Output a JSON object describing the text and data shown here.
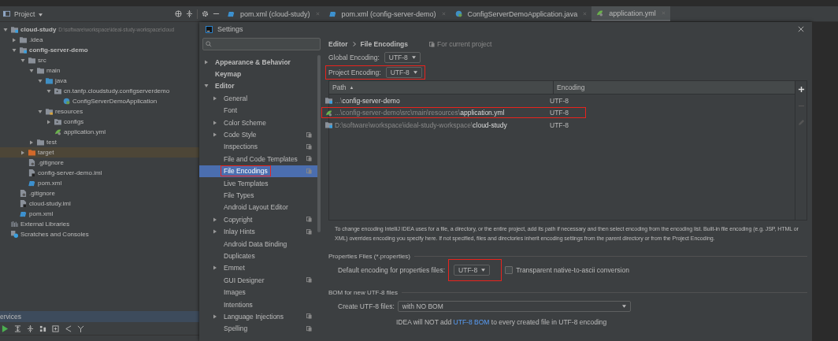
{
  "project_header": {
    "title": "Project"
  },
  "editor_tabs": [
    {
      "label": "pom.xml (cloud-study)",
      "kind": "maven",
      "selected": false
    },
    {
      "label": "pom.xml (config-server-demo)",
      "kind": "maven",
      "selected": false
    },
    {
      "label": "ConfigServerDemoApplication.java",
      "kind": "class",
      "selected": false
    },
    {
      "label": "application.yml",
      "kind": "yaml",
      "selected": true
    }
  ],
  "project_tree": [
    {
      "kind": "module",
      "name": "cloud-study",
      "hint": "D:\\software\\workspace\\ideal-study-workspace\\cloud",
      "expanded": true,
      "children": [
        {
          "kind": "folder",
          "name": ".idea",
          "expanded": false
        },
        {
          "kind": "module",
          "name": "config-server-demo",
          "expanded": true,
          "children": [
            {
              "kind": "folder",
              "name": "src",
              "expanded": true,
              "children": [
                {
                  "kind": "folder",
                  "name": "main",
                  "expanded": true,
                  "children": [
                    {
                      "kind": "source-folder",
                      "name": "java",
                      "expanded": true,
                      "children": [
                        {
                          "kind": "package",
                          "name": "cn.tanfp.cloudstudy.configserverdemo",
                          "expanded": true,
                          "children": [
                            {
                              "kind": "class",
                              "name": "ConfigServerDemoApplication"
                            }
                          ]
                        }
                      ]
                    },
                    {
                      "kind": "resources-folder",
                      "name": "resources",
                      "expanded": true,
                      "children": [
                        {
                          "kind": "package",
                          "name": "configs",
                          "expanded": false
                        },
                        {
                          "kind": "yaml",
                          "name": "application.yml"
                        }
                      ]
                    }
                  ]
                },
                {
                  "kind": "folder",
                  "name": "test",
                  "expanded": false
                }
              ]
            },
            {
              "kind": "excluded-folder",
              "name": "target",
              "expanded": false
            },
            {
              "kind": "gitignore",
              "name": ".gitignore"
            },
            {
              "kind": "iml",
              "name": "config-server-demo.iml"
            },
            {
              "kind": "maven",
              "name": "pom.xml"
            }
          ]
        },
        {
          "kind": "gitignore",
          "name": ".gitignore"
        },
        {
          "kind": "iml",
          "name": "cloud-study.iml"
        },
        {
          "kind": "maven",
          "name": "pom.xml"
        }
      ]
    },
    {
      "kind": "libraries",
      "name": "External Libraries"
    },
    {
      "kind": "scratches",
      "name": "Scratches and Consoles"
    }
  ],
  "services": {
    "title": "ervices"
  },
  "settings": {
    "title": "Settings",
    "sidebar": [
      {
        "label": "Appearance & Behavior",
        "expanded": false,
        "project_level": false,
        "selected": false
      },
      {
        "label": "Keymap",
        "project_level": false,
        "selected": false
      },
      {
        "label": "Editor",
        "expanded": true,
        "project_level": false,
        "selected": false,
        "children": [
          {
            "label": "General",
            "expanded": false,
            "project_level": false,
            "selected": false
          },
          {
            "label": "Font",
            "project_level": false,
            "selected": false
          },
          {
            "label": "Color Scheme",
            "expanded": false,
            "project_level": false,
            "selected": false
          },
          {
            "label": "Code Style",
            "expanded": false,
            "project_level": true,
            "selected": false
          },
          {
            "label": "Inspections",
            "project_level": true,
            "selected": false
          },
          {
            "label": "File and Code Templates",
            "project_level": true,
            "selected": false
          },
          {
            "label": "File Encodings",
            "project_level": true,
            "selected": true,
            "highlighted": true
          },
          {
            "label": "Live Templates",
            "project_level": false,
            "selected": false
          },
          {
            "label": "File Types",
            "project_level": false,
            "selected": false
          },
          {
            "label": "Android Layout Editor",
            "project_level": false,
            "selected": false
          },
          {
            "label": "Copyright",
            "expanded": false,
            "project_level": true,
            "selected": false
          },
          {
            "label": "Inlay Hints",
            "expanded": false,
            "project_level": true,
            "selected": false
          },
          {
            "label": "Android Data Binding",
            "project_level": false,
            "selected": false
          },
          {
            "label": "Duplicates",
            "project_level": false,
            "selected": false
          },
          {
            "label": "Emmet",
            "expanded": false,
            "project_level": false,
            "selected": false
          },
          {
            "label": "GUI Designer",
            "project_level": true,
            "selected": false
          },
          {
            "label": "Images",
            "project_level": false,
            "selected": false
          },
          {
            "label": "Intentions",
            "project_level": false,
            "selected": false
          },
          {
            "label": "Language Injections",
            "expanded": false,
            "project_level": true,
            "selected": false
          },
          {
            "label": "Spelling",
            "project_level": true,
            "selected": false
          }
        ]
      }
    ],
    "breadcrumb": [
      "Editor",
      "File Encodings"
    ],
    "scope_note": "For current project",
    "global_encoding": {
      "label": "Global Encoding:",
      "value": "UTF-8"
    },
    "project_encoding": {
      "label": "Project Encoding:",
      "value": "UTF-8",
      "highlighted": true
    },
    "table": {
      "columns": [
        {
          "label": "Path",
          "sort_mark": "▲"
        },
        {
          "label": "Encoding"
        }
      ],
      "rows": [
        {
          "kind": "module",
          "path": "...\\**config-server-demo**",
          "encoding": "UTF-8",
          "highlighted": false
        },
        {
          "kind": "yaml",
          "path": "...\\config-server-demo\\src\\main\\resources\\**application.yml**",
          "encoding": "UTF-8",
          "highlighted": true
        },
        {
          "kind": "module",
          "path": "D:\\software\\workspace\\ideal-study-workspace\\**cloud-study**",
          "encoding": "UTF-8",
          "highlighted": false
        }
      ]
    },
    "description": "To change encoding IntelliJ IDEA uses for a file, a directory, or the entire project, add its path if necessary and then select encoding from the encoding list. Built-in file encoding (e.g. JSP, HTML or XML) overrides encoding you specify here. If not specified, files and directories inherit encoding settings from the parent directory or from the Project Encoding.",
    "properties": {
      "section": "Properties Files (*.properties)",
      "label": "Default encoding for properties files:",
      "value": "UTF-8",
      "highlighted": true,
      "transparent": {
        "label": "Transparent native-to-ascii conversion",
        "checked": false
      }
    },
    "bom": {
      "section": "BOM for new UTF-8 files",
      "label": "Create UTF-8 files:",
      "value": "with NO BOM",
      "note": {
        "before": "IDEA will NOT add ",
        "link": "UTF-8 BOM",
        "after": " to every created file in UTF-8 encoding"
      }
    }
  }
}
